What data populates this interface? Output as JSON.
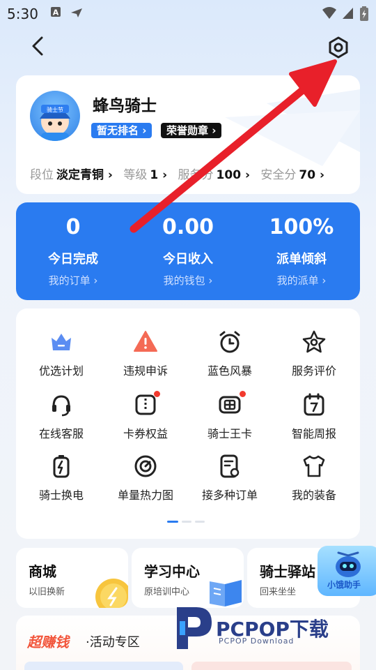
{
  "status_bar": {
    "time": "5:30"
  },
  "profile": {
    "name": "蜂鸟骑士",
    "rank_badge": "暂无排名",
    "honor_badge": "荣誉勋章",
    "stats": [
      {
        "label": "段位",
        "value": "淡定青铜"
      },
      {
        "label": "等级",
        "value": "1"
      },
      {
        "label": "服务分",
        "value": "100"
      },
      {
        "label": "安全分",
        "value": "70"
      }
    ]
  },
  "metrics": [
    {
      "value": "0",
      "label": "今日完成",
      "link": "我的订单"
    },
    {
      "value": "0.00",
      "label": "今日收入",
      "link": "我的钱包"
    },
    {
      "value": "100%",
      "label": "派单倾斜",
      "link": "我的派单"
    }
  ],
  "tools": [
    {
      "label": "优选计划",
      "icon": "crown-icon"
    },
    {
      "label": "违规申诉",
      "icon": "warning-icon"
    },
    {
      "label": "蓝色风暴",
      "icon": "alarm-clock-icon"
    },
    {
      "label": "服务评价",
      "icon": "star-icon"
    },
    {
      "label": "在线客服",
      "icon": "headset-icon"
    },
    {
      "label": "卡券权益",
      "icon": "coupon-icon"
    },
    {
      "label": "骑士王卡",
      "icon": "card-icon"
    },
    {
      "label": "智能周报",
      "icon": "calendar-icon"
    },
    {
      "label": "骑士换电",
      "icon": "battery-icon"
    },
    {
      "label": "单量热力图",
      "icon": "heatmap-icon"
    },
    {
      "label": "接多种订单",
      "icon": "order-icon"
    },
    {
      "label": "我的装备",
      "icon": "tshirt-icon"
    }
  ],
  "services": [
    {
      "title": "商城",
      "subtitle": "以旧换新"
    },
    {
      "title": "学习中心",
      "subtitle": "原培训中心"
    },
    {
      "title": "骑士驿站",
      "subtitle": "回来坐坐"
    }
  ],
  "activity": {
    "brand": "超赚钱",
    "title": "·活动专区"
  },
  "assistant": {
    "label": "小饿助手"
  },
  "watermark": {
    "title": "PCPOP下载",
    "subtitle": "PCPOP Download"
  },
  "colors": {
    "accent": "#2a7bf0",
    "alert": "#f23a2e",
    "annotation_arrow": "#e8202a"
  }
}
